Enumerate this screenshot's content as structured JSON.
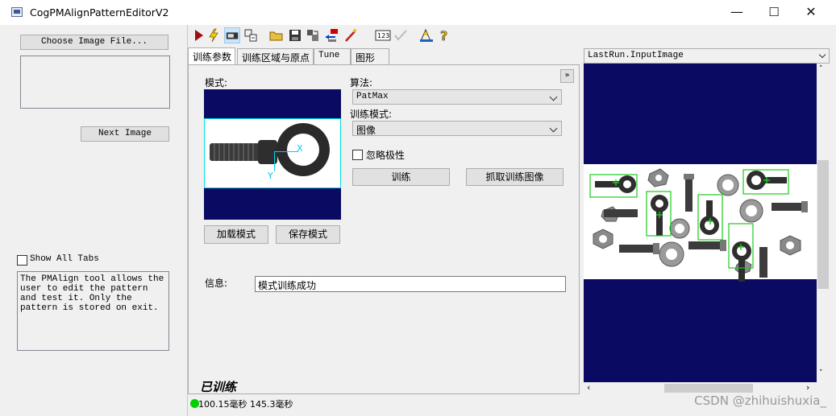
{
  "window": {
    "title": "CogPMAlignPatternEditorV2",
    "minimize": "—",
    "maximize": "☐",
    "close": "✕"
  },
  "left": {
    "choose_image": "Choose Image File...",
    "next_image": "Next Image",
    "show_all_tabs": "Show All Tabs",
    "description": "The PMAlign tool allows the user to edit the pattern and test it. Only the pattern is stored on exit."
  },
  "toolbar": {
    "icons": [
      "run-icon",
      "electric-icon",
      "display-icon",
      "grid-icon",
      "open-icon",
      "save-icon",
      "transfer-icon",
      "reset-icon",
      "wand-icon",
      "counter-icon",
      "disabled-icon",
      "measure-icon",
      "help-icon"
    ]
  },
  "tabs": [
    "训练参数",
    "训练区域与原点",
    "Tune",
    "图形"
  ],
  "train": {
    "pattern_label": "模式:",
    "algorithm_label": "算法:",
    "algorithm_value": "PatMax",
    "train_mode_label": "训练模式:",
    "train_mode_value": "图像",
    "ignore_polarity": "忽略极性",
    "train_button": "训练",
    "grab_button": "抓取训练图像",
    "load_pattern": "加载模式",
    "save_pattern": "保存模式",
    "info_label": "信息:",
    "info_value": "模式训练成功",
    "trained_status": "已训练",
    "x_marker": "X",
    "y_marker": "Y"
  },
  "image_panel": {
    "title": "LastRun.InputImage"
  },
  "status": {
    "timing": "100.15毫秒 145.3毫秒",
    "indicator_color": "#00d000"
  },
  "watermark": "CSDN @zhihuishuxia_"
}
